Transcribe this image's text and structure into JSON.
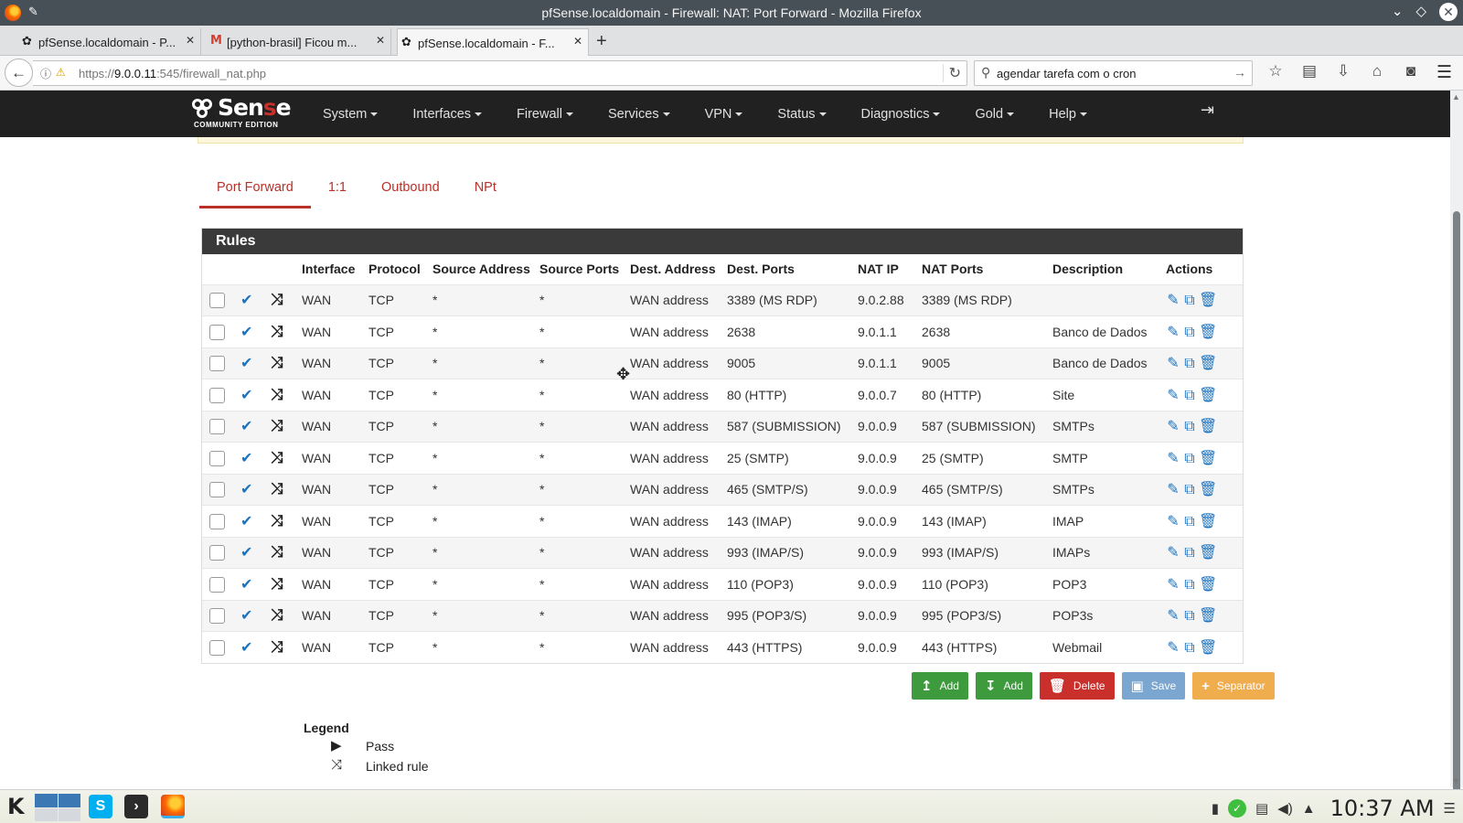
{
  "window": {
    "title": "pfSense.localdomain - Firewall: NAT: Port Forward - Mozilla Firefox"
  },
  "tabs": [
    {
      "label": "pfSense.localdomain - P...",
      "icon": "pfsense-icon"
    },
    {
      "label": "[python-brasil] Ficou m...",
      "icon": "gmail-icon"
    },
    {
      "label": "pfSense.localdomain - F...",
      "icon": "pfsense-icon",
      "active": true
    }
  ],
  "navbar": {
    "url_prefix": "https://",
    "url_host": "9.0.0.11",
    "url_rest": ":545/firewall_nat.php",
    "search_value": "agendar tarefa com o cron"
  },
  "pfsense": {
    "logo_word_1": "Sen",
    "logo_word_2": "s",
    "logo_word_3": "e",
    "edition": "COMMUNITY EDITION",
    "menu": [
      "System",
      "Interfaces",
      "Firewall",
      "Services",
      "VPN",
      "Status",
      "Diagnostics",
      "Gold",
      "Help"
    ]
  },
  "subtabs": [
    "Port Forward",
    "1:1",
    "Outbound",
    "NPt"
  ],
  "rules": {
    "title": "Rules",
    "columns": [
      "Interface",
      "Protocol",
      "Source Address",
      "Source Ports",
      "Dest. Address",
      "Dest. Ports",
      "NAT IP",
      "NAT Ports",
      "Description",
      "Actions"
    ],
    "rows": [
      {
        "interface": "WAN",
        "protocol": "TCP",
        "src_addr": "*",
        "src_ports": "*",
        "dst_addr": "WAN address",
        "dst_ports": "3389 (MS RDP)",
        "nat_ip": "9.0.2.88",
        "nat_ports": "3389 (MS RDP)",
        "description": ""
      },
      {
        "interface": "WAN",
        "protocol": "TCP",
        "src_addr": "*",
        "src_ports": "*",
        "dst_addr": "WAN address",
        "dst_ports": "2638",
        "nat_ip": "9.0.1.1",
        "nat_ports": "2638",
        "description": "Banco de Dados"
      },
      {
        "interface": "WAN",
        "protocol": "TCP",
        "src_addr": "*",
        "src_ports": "*",
        "dst_addr": "WAN address",
        "dst_ports": "9005",
        "nat_ip": "9.0.1.1",
        "nat_ports": "9005",
        "description": "Banco de Dados"
      },
      {
        "interface": "WAN",
        "protocol": "TCP",
        "src_addr": "*",
        "src_ports": "*",
        "dst_addr": "WAN address",
        "dst_ports": "80 (HTTP)",
        "nat_ip": "9.0.0.7",
        "nat_ports": "80 (HTTP)",
        "description": "Site"
      },
      {
        "interface": "WAN",
        "protocol": "TCP",
        "src_addr": "*",
        "src_ports": "*",
        "dst_addr": "WAN address",
        "dst_ports": "587 (SUBMISSION)",
        "nat_ip": "9.0.0.9",
        "nat_ports": "587 (SUBMISSION)",
        "description": "SMTPs"
      },
      {
        "interface": "WAN",
        "protocol": "TCP",
        "src_addr": "*",
        "src_ports": "*",
        "dst_addr": "WAN address",
        "dst_ports": "25 (SMTP)",
        "nat_ip": "9.0.0.9",
        "nat_ports": "25 (SMTP)",
        "description": "SMTP"
      },
      {
        "interface": "WAN",
        "protocol": "TCP",
        "src_addr": "*",
        "src_ports": "*",
        "dst_addr": "WAN address",
        "dst_ports": "465 (SMTP/S)",
        "nat_ip": "9.0.0.9",
        "nat_ports": "465 (SMTP/S)",
        "description": "SMTPs"
      },
      {
        "interface": "WAN",
        "protocol": "TCP",
        "src_addr": "*",
        "src_ports": "*",
        "dst_addr": "WAN address",
        "dst_ports": "143 (IMAP)",
        "nat_ip": "9.0.0.9",
        "nat_ports": "143 (IMAP)",
        "description": "IMAP"
      },
      {
        "interface": "WAN",
        "protocol": "TCP",
        "src_addr": "*",
        "src_ports": "*",
        "dst_addr": "WAN address",
        "dst_ports": "993 (IMAP/S)",
        "nat_ip": "9.0.0.9",
        "nat_ports": "993 (IMAP/S)",
        "description": "IMAPs"
      },
      {
        "interface": "WAN",
        "protocol": "TCP",
        "src_addr": "*",
        "src_ports": "*",
        "dst_addr": "WAN address",
        "dst_ports": "110 (POP3)",
        "nat_ip": "9.0.0.9",
        "nat_ports": "110 (POP3)",
        "description": "POP3"
      },
      {
        "interface": "WAN",
        "protocol": "TCP",
        "src_addr": "*",
        "src_ports": "*",
        "dst_addr": "WAN address",
        "dst_ports": "995 (POP3/S)",
        "nat_ip": "9.0.0.9",
        "nat_ports": "995 (POP3/S)",
        "description": "POP3s"
      },
      {
        "interface": "WAN",
        "protocol": "TCP",
        "src_addr": "*",
        "src_ports": "*",
        "dst_addr": "WAN address",
        "dst_ports": "443 (HTTPS)",
        "nat_ip": "9.0.0.9",
        "nat_ports": "443 (HTTPS)",
        "description": "Webmail"
      }
    ]
  },
  "buttons": {
    "add_top": "Add",
    "add_bottom": "Add",
    "delete": "Delete",
    "save": "Save",
    "separator": "Separator"
  },
  "legend": {
    "title": "Legend",
    "pass": "Pass",
    "linked": "Linked rule"
  },
  "taskbar": {
    "clock": "10:37 AM"
  },
  "colors": {
    "brand_red": "#b83027",
    "navbar_bg": "#212121",
    "action_blue": "#1e73be",
    "add_green": "#3d9a3d",
    "delete_red": "#c9302c",
    "save_blue": "#7ba6cf",
    "separator_orange": "#f0ad4e"
  }
}
